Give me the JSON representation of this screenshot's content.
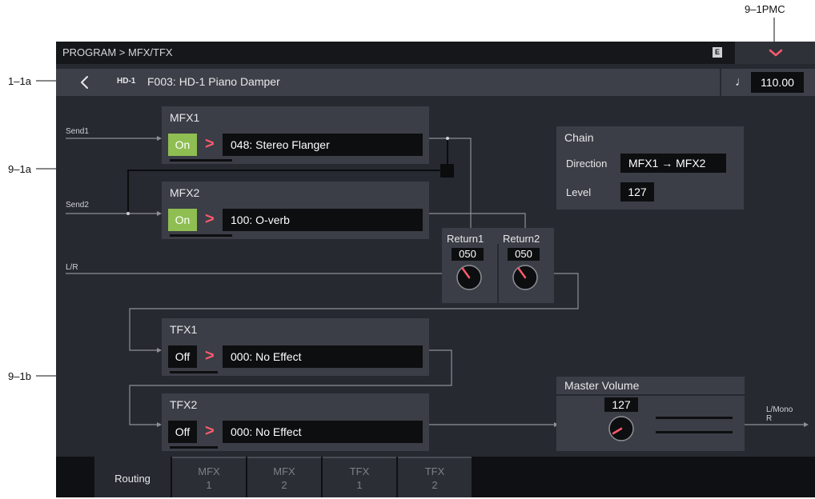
{
  "callouts": {
    "top_right": "9–1PMC",
    "program_row": "1–1a",
    "mfx_routing": "9–1a",
    "tfx_routing": "9–1b"
  },
  "titlebar": {
    "breadcrumb": "PROGRAM > MFX/TFX",
    "edit_badge": "E"
  },
  "program": {
    "bank_badge": "HD-1",
    "name": "F003: HD-1 Piano Damper",
    "tempo": "110.00"
  },
  "signals": {
    "send1": "Send1",
    "send2": "Send2",
    "lr": "L/R",
    "output_l": "L/Mono",
    "output_r": "R"
  },
  "mfx1": {
    "title": "MFX1",
    "state": "On",
    "effect": "048: Stereo Flanger"
  },
  "mfx2": {
    "title": "MFX2",
    "state": "On",
    "effect": "100: O-verb"
  },
  "tfx1": {
    "title": "TFX1",
    "state": "Off",
    "effect": "000: No Effect"
  },
  "tfx2": {
    "title": "TFX2",
    "state": "Off",
    "effect": "000: No Effect"
  },
  "chain": {
    "title": "Chain",
    "direction_label": "Direction",
    "direction_value": "MFX1 → MFX2",
    "level_label": "Level",
    "level_value": "127"
  },
  "returns": {
    "return1": {
      "label": "Return1",
      "value": "050"
    },
    "return2": {
      "label": "Return2",
      "value": "050"
    }
  },
  "master": {
    "title": "Master Volume",
    "value": "127"
  },
  "tabs": [
    {
      "label": "Routing"
    },
    {
      "line1": "MFX",
      "line2": "1"
    },
    {
      "line1": "MFX",
      "line2": "2"
    },
    {
      "line1": "TFX",
      "line2": "1"
    },
    {
      "line1": "TFX",
      "line2": "2"
    }
  ],
  "colors": {
    "on_button": "#8fbe52",
    "chevron": "#ff5a6e",
    "background": "#262930",
    "panel": "#3b3e46"
  },
  "icons": [
    "back-chevron-icon",
    "collapse-chevron-icon",
    "quarter-note-icon",
    "knob-icon",
    "edit-badge-icon"
  ]
}
